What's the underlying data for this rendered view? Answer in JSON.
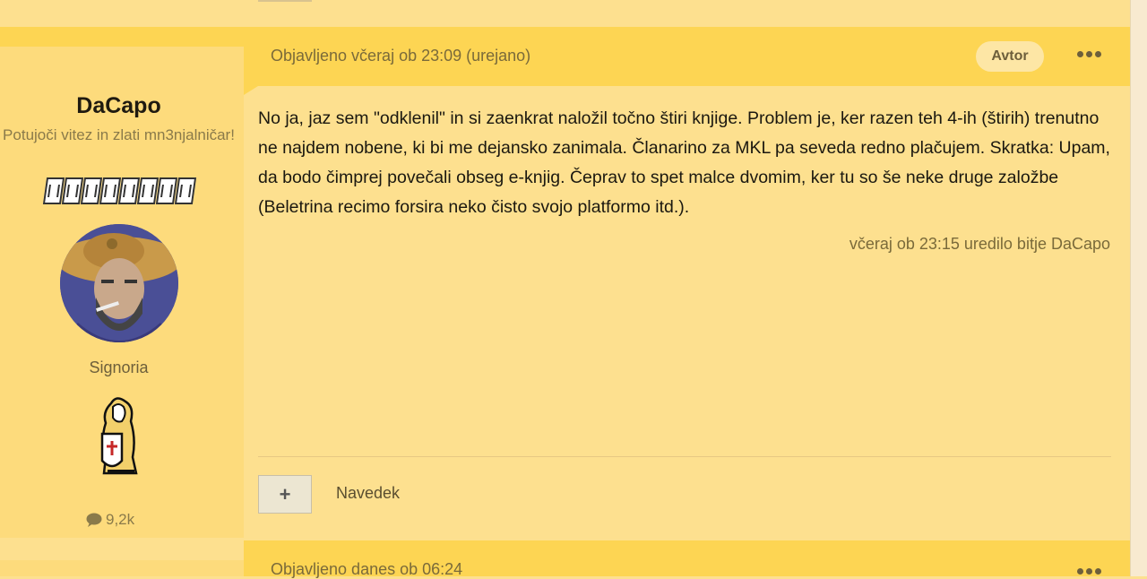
{
  "post1": {
    "date": "Objavljeno včeraj ob 23:09 (urejano)",
    "author_badge": "Avtor",
    "author": {
      "name": "DaCapo",
      "title": "Potujoči vitez in zlati mn3njalničar!",
      "group": "Signoria",
      "post_count": "9,2k"
    },
    "body": "No ja, jaz sem \"odklenil\" in si zaenkrat naložil točno štiri knjige. Problem je, ker razen teh 4-ih (štirih) trenutno ne najdem nobene, ki bi me dejansko zanimala. Članarino za MKL pa seveda redno plačujem. Skratka: Upam, da bodo čimprej povečali obseg e-knjig.  Čeprav to spet malce dvomim, ker tu so še neke druge založbe (Beletrina recimo forsira neko čisto svojo platformo itd.).",
    "edited": "včeraj ob 23:15 uredilo bitje DaCapo",
    "quote_button": "+",
    "quote_label": "Navedek"
  },
  "post2": {
    "date": "Objavljeno danes ob 06:24"
  },
  "colors": {
    "page_bg": "#fde08f",
    "header_bg": "#fdd553",
    "author_bg": "#fddb7c",
    "text": "#1b1810",
    "muted": "#7a6a3a"
  },
  "icons": {
    "more": "ellipsis-icon",
    "post_count": "comment-icon",
    "group": "lion-shield-icon"
  }
}
